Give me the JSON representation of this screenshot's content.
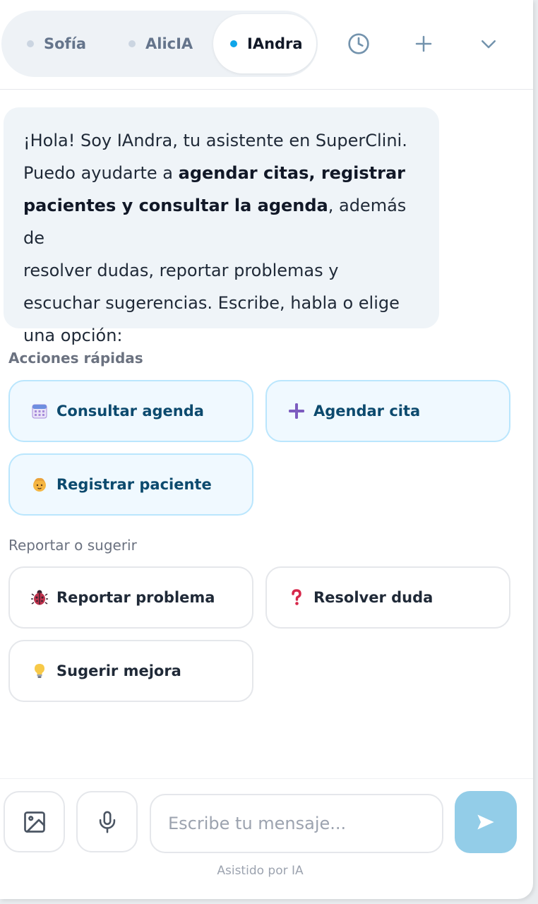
{
  "tabs": [
    {
      "label": "Sofía"
    },
    {
      "label": "AlicIA"
    },
    {
      "label": "IAndra"
    }
  ],
  "header_icons": [
    "history-icon",
    "plus-icon",
    "chevron-down-icon"
  ],
  "message": {
    "line1": "¡Hola! Soy IAndra, tu asistente en SuperClini.",
    "line2_pre": "Puedo ayudarte a ",
    "line2_bold": "agendar citas, registrar",
    "line3_bold": "pacientes y consultar la agenda",
    "line3_post": ", además de",
    "line4": "resolver dudas, reportar problemas y",
    "line5": "escuchar sugerencias. Escribe, habla o elige",
    "line6": "una opción:"
  },
  "quick_actions": {
    "title": "Acciones rápidas",
    "items": [
      {
        "label": "Consultar agenda",
        "icon": "calendar-icon"
      },
      {
        "label": "Agendar cita",
        "icon": "plus-icon"
      },
      {
        "label": "Registrar paciente",
        "icon": "person-icon"
      }
    ]
  },
  "report_actions": {
    "title": "Reportar o sugerir",
    "items": [
      {
        "label": "Reportar problema",
        "icon": "bug-icon"
      },
      {
        "label": "Resolver duda",
        "icon": "question-icon"
      },
      {
        "label": "Sugerir mejora",
        "icon": "lightbulb-icon"
      }
    ]
  },
  "composer": {
    "placeholder": "Escribe tu mensaje...",
    "footnote": "Asistido por IA"
  },
  "colors": {
    "accent": "#0ea5e9",
    "send_button": "#93cde8",
    "quick_bg": "#f0f9ff",
    "quick_border": "#bae6fd"
  }
}
